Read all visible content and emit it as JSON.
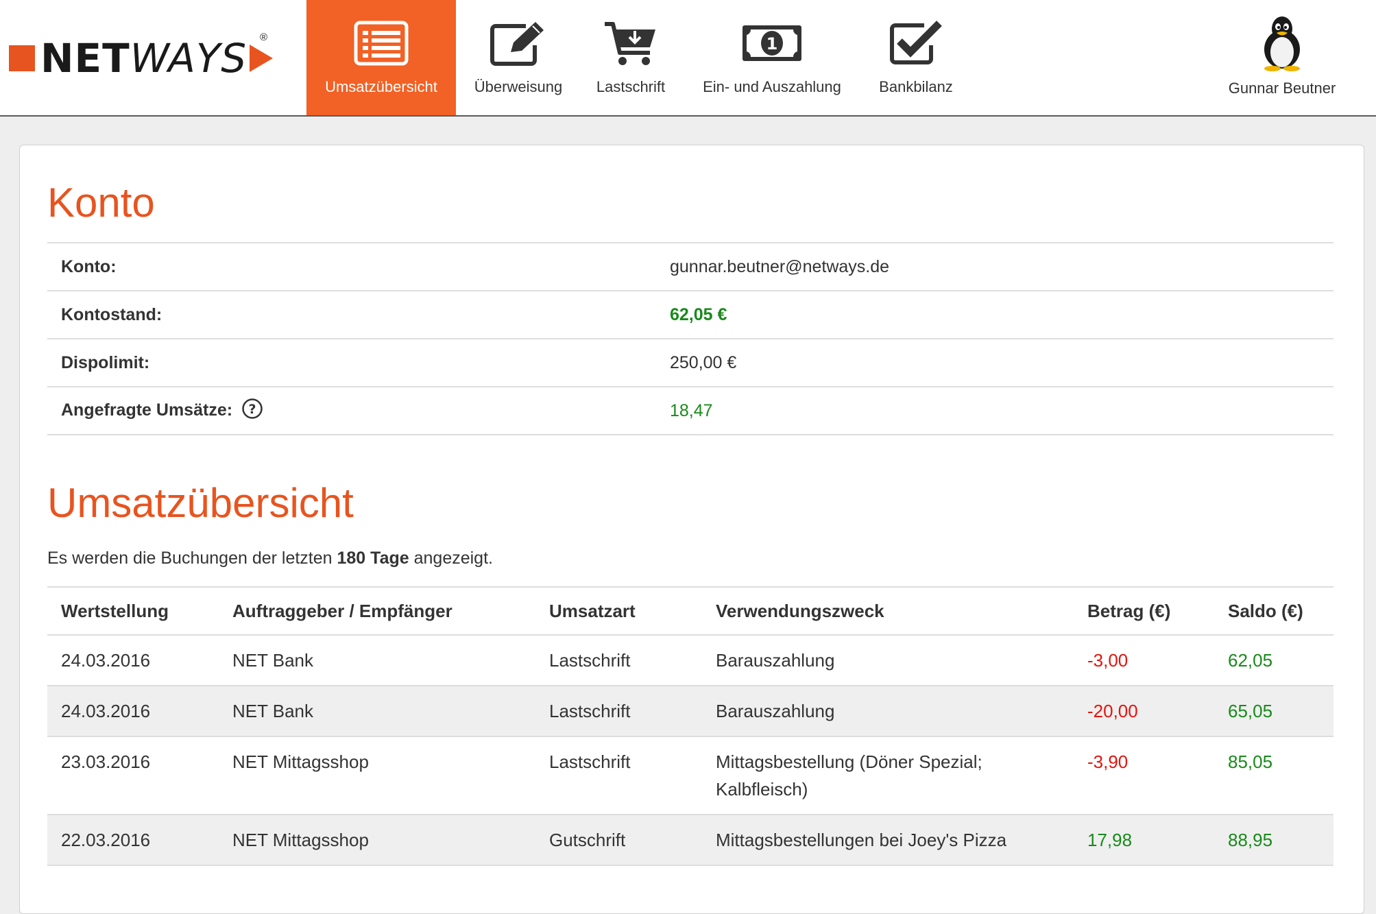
{
  "brand": {
    "name_bold": "NET",
    "name_italic": "WAYS",
    "registered": "®",
    "colors": {
      "accent": "#f26125",
      "title": "#e8541f",
      "positive": "#188a1a",
      "negative": "#e3140e"
    }
  },
  "nav": {
    "items": [
      {
        "label": "Umsatzübersicht",
        "icon": "list-icon",
        "active": true
      },
      {
        "label": "Überweisung",
        "icon": "edit-icon",
        "active": false
      },
      {
        "label": "Lastschrift",
        "icon": "cart-download-icon",
        "active": false
      },
      {
        "label": "Ein- und Auszahlung",
        "icon": "banknote-icon",
        "active": false
      },
      {
        "label": "Bankbilanz",
        "icon": "checkbox-icon",
        "active": false
      }
    ],
    "user": {
      "name": "Gunnar Beutner",
      "icon": "tux-avatar-icon"
    }
  },
  "account": {
    "title": "Konto",
    "rows": [
      {
        "label": "Konto:",
        "value": "gunnar.beutner@netways.de"
      },
      {
        "label": "Kontostand:",
        "value": "62,05 €"
      },
      {
        "label": "Dispolimit:",
        "value": "250,00 €"
      },
      {
        "label": "Angefragte Umsätze:",
        "value": "18,47",
        "help_icon": "question-circle-icon"
      }
    ]
  },
  "transactions": {
    "title": "Umsatzübersicht",
    "info_prefix": "Es werden die Buchungen der letzten ",
    "info_bold": "180 Tage",
    "info_suffix": " angezeigt.",
    "columns": [
      "Wertstellung",
      "Auftraggeber / Empfänger",
      "Umsatzart",
      "Verwendungszweck",
      "Betrag (€)",
      "Saldo (€)"
    ],
    "rows": [
      {
        "date": "24.03.2016",
        "party": "NET Bank",
        "type": "Lastschrift",
        "purpose": "Barauszahlung",
        "amount": "-3,00",
        "balance": "62,05"
      },
      {
        "date": "24.03.2016",
        "party": "NET Bank",
        "type": "Lastschrift",
        "purpose": "Barauszahlung",
        "amount": "-20,00",
        "balance": "65,05"
      },
      {
        "date": "23.03.2016",
        "party": "NET Mittagsshop",
        "type": "Lastschrift",
        "purpose": "Mittagsbestellung (Döner Spezial; Kalbfleisch)",
        "amount": "-3,90",
        "balance": "85,05"
      },
      {
        "date": "22.03.2016",
        "party": "NET Mittagsshop",
        "type": "Gutschrift",
        "purpose": "Mittagsbestellungen bei Joey's Pizza",
        "amount": "17,98",
        "balance": "88,95"
      }
    ]
  }
}
